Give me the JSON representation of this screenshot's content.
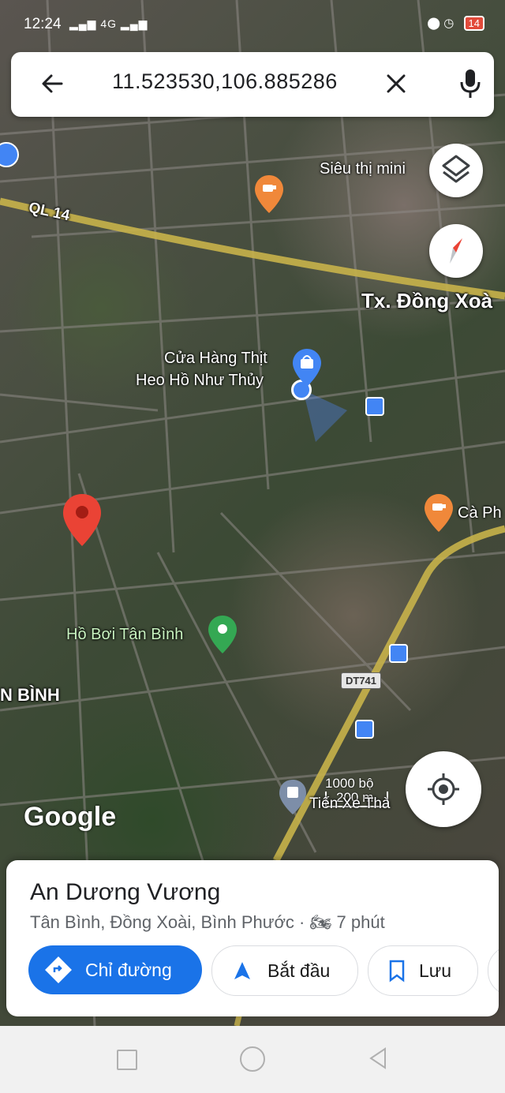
{
  "status_bar": {
    "time": "12:24",
    "signal": "4G",
    "battery": "14"
  },
  "search": {
    "query": "11.523530,106.885286",
    "back_icon": "arrow-left-icon",
    "clear_icon": "close-icon",
    "mic_icon": "microphone-icon"
  },
  "map": {
    "road_labels": [
      {
        "text": "QL 14"
      },
      {
        "text": "Tx. Đồng Xoà"
      },
      {
        "text": "N BÌNH"
      }
    ],
    "route_shield": "DT741",
    "pois": [
      {
        "name": "Siêu thị mini",
        "icon": "cafe-icon"
      },
      {
        "line1": "Cửa Hàng Thịt",
        "line2": "Heo Hồ Như Thủy",
        "icon": "shopping-bag-icon"
      },
      {
        "name": "Cà Ph",
        "icon": "cafe-icon"
      },
      {
        "name": "Hồ Bơi Tân Bình",
        "icon": "green-pin-icon"
      }
    ],
    "scale": {
      "label1": "1000 bộ",
      "label2": "200 m"
    },
    "partial_label": "Tiến Xe Thà",
    "watermark": "Google",
    "accent": "#fbc02d"
  },
  "bottom_sheet": {
    "title": "An Dương Vương",
    "address": "Tân Bình, Đồng Xoài, Bình Phước · ",
    "travel_time": "7 phút",
    "buttons": [
      {
        "label": "Chỉ đường",
        "icon": "directions-icon"
      },
      {
        "label": "Bắt đầu",
        "icon": "navigation-arrow-icon"
      },
      {
        "label": "Lưu",
        "icon": "bookmark-icon"
      }
    ],
    "primary_color": "#1a73e8"
  },
  "nav_bar": {
    "items": [
      "recents-icon",
      "home-icon",
      "back-icon"
    ]
  }
}
